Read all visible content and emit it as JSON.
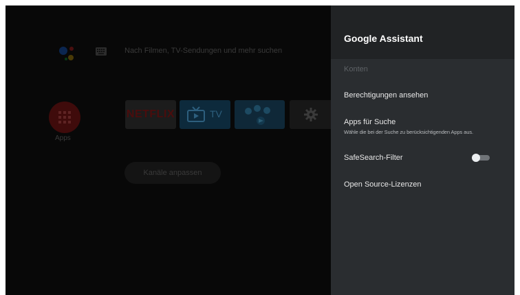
{
  "home": {
    "search_hint": "Nach Filmen, TV-Sendungen und mehr suchen",
    "apps_label": "Apps",
    "netflix_label": "NETFLIX",
    "tv_label": "TV",
    "customize_channels_label": "Kanäle anpassen"
  },
  "panel": {
    "title": "Google Assistant",
    "items": [
      {
        "label": "Konten",
        "enabled": false
      },
      {
        "label": "Berechtigungen ansehen",
        "enabled": true
      },
      {
        "label": "Apps für Suche",
        "subtitle": "Wähle die bei der Suche zu berücksichtigenden Apps aus.",
        "enabled": true
      },
      {
        "label": "SafeSearch-Filter",
        "toggle": "off",
        "enabled": true
      },
      {
        "label": "Open Source-Lizenzen",
        "enabled": true
      }
    ]
  },
  "colors": {
    "panel_background": "#2a2d30",
    "panel_header": "#212325",
    "text_primary": "#e8e8e8",
    "text_disabled": "#5e6266"
  },
  "icons": [
    "google-assistant-icon",
    "keyboard-icon",
    "apps-grid-icon",
    "tv-icon",
    "settings-gear-icon",
    "toggle-switch"
  ]
}
